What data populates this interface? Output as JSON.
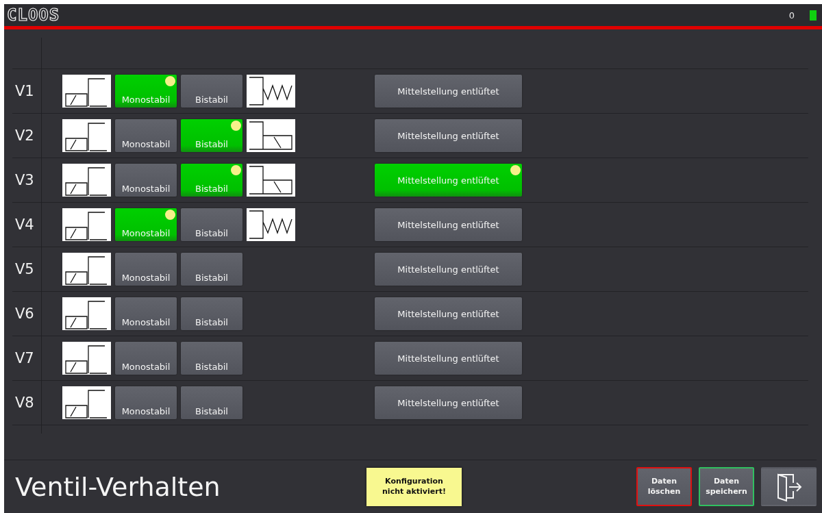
{
  "header": {
    "logo": "CLOOS",
    "counter": "0"
  },
  "valves": [
    {
      "label": "V1",
      "options": [
        {
          "label": "Monostabil",
          "selected": true
        },
        {
          "label": "Bistabil",
          "selected": false
        }
      ],
      "end_symbol": {
        "kind": "spring"
      },
      "center": {
        "label": "Mittelstellung entlüftet",
        "selected": false
      }
    },
    {
      "label": "V2",
      "options": [
        {
          "label": "Monostabil",
          "selected": false
        },
        {
          "label": "Bistabil",
          "selected": true
        }
      ],
      "end_symbol": {
        "kind": "detent"
      },
      "center": {
        "label": "Mittelstellung entlüftet",
        "selected": false
      }
    },
    {
      "label": "V3",
      "options": [
        {
          "label": "Monostabil",
          "selected": false
        },
        {
          "label": "Bistabil",
          "selected": true
        }
      ],
      "end_symbol": {
        "kind": "detent"
      },
      "center": {
        "label": "Mittelstellung entlüftet",
        "selected": true
      }
    },
    {
      "label": "V4",
      "options": [
        {
          "label": "Monostabil",
          "selected": true
        },
        {
          "label": "Bistabil",
          "selected": false
        }
      ],
      "end_symbol": {
        "kind": "spring"
      },
      "center": {
        "label": "Mittelstellung entlüftet",
        "selected": false
      }
    },
    {
      "label": "V5",
      "options": [
        {
          "label": "Monostabil",
          "selected": false
        },
        {
          "label": "Bistabil",
          "selected": false
        }
      ],
      "center": {
        "label": "Mittelstellung entlüftet",
        "selected": false
      }
    },
    {
      "label": "V6",
      "options": [
        {
          "label": "Monostabil",
          "selected": false
        },
        {
          "label": "Bistabil",
          "selected": false
        }
      ],
      "center": {
        "label": "Mittelstellung entlüftet",
        "selected": false
      }
    },
    {
      "label": "V7",
      "options": [
        {
          "label": "Monostabil",
          "selected": false
        },
        {
          "label": "Bistabil",
          "selected": false
        }
      ],
      "center": {
        "label": "Mittelstellung entlüftet",
        "selected": false
      }
    },
    {
      "label": "V8",
      "options": [
        {
          "label": "Monostabil",
          "selected": false
        },
        {
          "label": "Bistabil",
          "selected": false
        }
      ],
      "center": {
        "label": "Mittelstellung entlüftet",
        "selected": false
      }
    }
  ],
  "footer": {
    "title": "Ventil-Verhalten",
    "warning": [
      "Konfiguration",
      "nicht aktiviert!"
    ],
    "buttons": [
      {
        "kind": "delete",
        "lines": [
          "Daten",
          "löschen"
        ]
      },
      {
        "kind": "save",
        "lines": [
          "Daten",
          "speichern"
        ]
      },
      {
        "kind": "exit"
      }
    ]
  }
}
